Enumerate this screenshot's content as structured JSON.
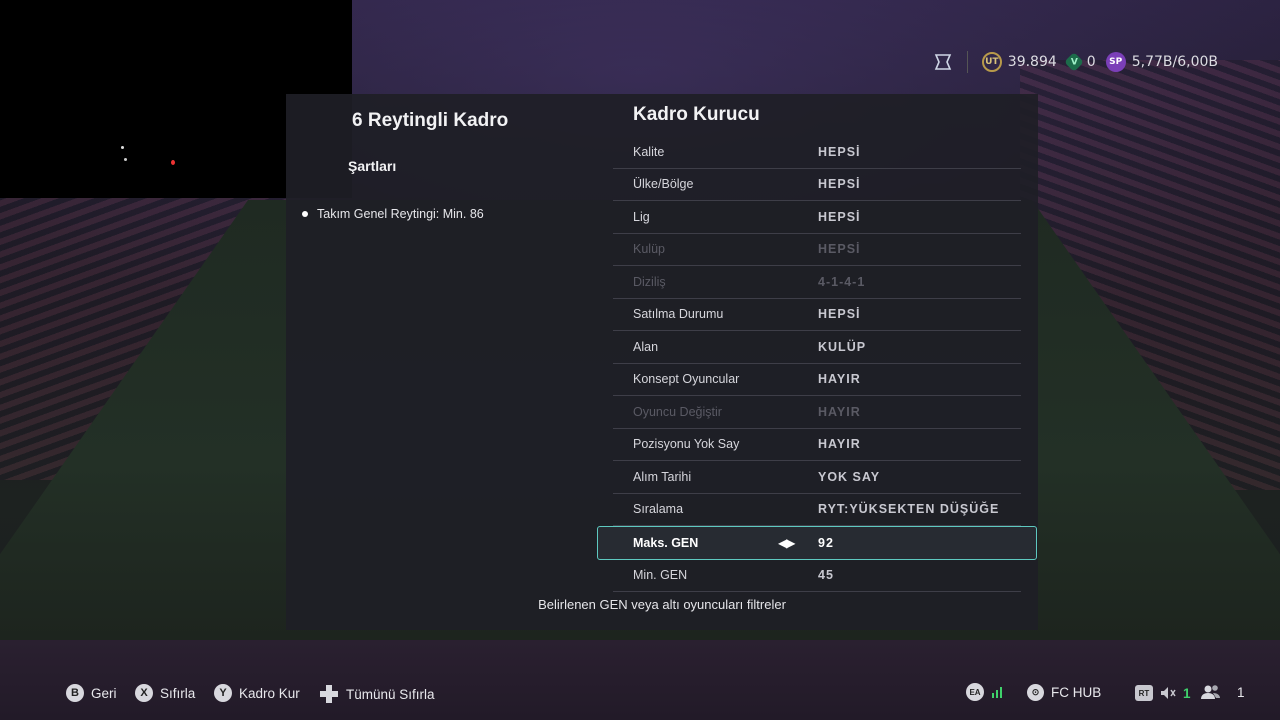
{
  "header": {
    "currencies": [
      {
        "icon": "ut-coin-icon",
        "label": "UT",
        "value": "39.894"
      },
      {
        "icon": "fc-points-icon",
        "label": "V",
        "value": "0"
      },
      {
        "icon": "sp-icon",
        "label": "SP",
        "value": "5,77B/6,00B"
      }
    ]
  },
  "sbc": {
    "title": "6 Reytingli Kadro",
    "requirements_heading": "Şartları",
    "requirements": [
      "Takım Genel Reytingi: Min. 86"
    ]
  },
  "builder": {
    "title": "Kadro Kurucu",
    "rows": [
      {
        "label": "Kalite",
        "value": "HEPSİ",
        "disabled": false
      },
      {
        "label": "Ülke/Bölge",
        "value": "HEPSİ",
        "disabled": false
      },
      {
        "label": "Lig",
        "value": "HEPSİ",
        "disabled": false
      },
      {
        "label": "Kulüp",
        "value": "HEPSİ",
        "disabled": true
      },
      {
        "label": "Diziliş",
        "value": "4-1-4-1",
        "disabled": true
      },
      {
        "label": "Satılma Durumu",
        "value": "HEPSİ",
        "disabled": false
      },
      {
        "label": "Alan",
        "value": "KULÜP",
        "disabled": false
      },
      {
        "label": "Konsept Oyuncular",
        "value": "HAYIR",
        "disabled": false
      },
      {
        "label": "Oyuncu Değiştir",
        "value": "HAYIR",
        "disabled": true
      },
      {
        "label": "Pozisyonu Yok Say",
        "value": "HAYIR",
        "disabled": false
      },
      {
        "label": "Alım Tarihi",
        "value": "YOK SAY",
        "disabled": false
      },
      {
        "label": "Sıralama",
        "value": "RYT:YÜKSEKTEN DÜŞÜĞE",
        "disabled": false
      },
      {
        "label": "Maks. GEN",
        "value": "92",
        "disabled": false,
        "selected": true
      },
      {
        "label": "Min. GEN",
        "value": "45",
        "disabled": false
      }
    ],
    "hint": "Belirlenen GEN veya altı oyuncuları filtreler"
  },
  "footer": {
    "back": {
      "key": "B",
      "label": "Geri"
    },
    "reset": {
      "key": "X",
      "label": "Sıfırla"
    },
    "build": {
      "key": "Y",
      "label": "Kadro Kur"
    },
    "reset_all": {
      "label": "Tümünü Sıfırla"
    },
    "hub_label": "FC HUB",
    "rt_label": "RT",
    "voice_count": "1",
    "party_count": "1"
  }
}
